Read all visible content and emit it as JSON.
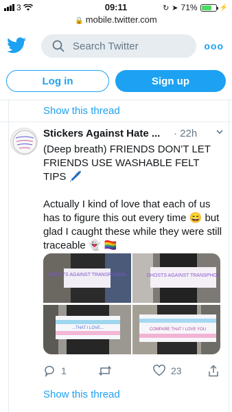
{
  "status_bar": {
    "carrier": "3",
    "time": "09:11",
    "battery": "71%",
    "battery_level": 0.71
  },
  "url_bar": {
    "url": "mobile.twitter.com"
  },
  "header": {
    "search_placeholder": "Search Twitter",
    "more_label": "ooo"
  },
  "auth": {
    "login_label": "Log in",
    "signup_label": "Sign up"
  },
  "thread_links": {
    "show_thread": "Show this thread"
  },
  "tweet": {
    "display_name": "Stickers Against Hate ...",
    "time": "22h",
    "text_line1": "(Deep breath) FRIENDS DON’T LET FRIENDS USE WASHABLE FELT TIPS 🖊️",
    "text_line2": "Actually I kind of love that each of us has to figure this out every time 😄 but glad I caught these while they were still traceable 👻 🏳️‍🌈",
    "replies": "1",
    "retweets": "",
    "likes": "23"
  },
  "media": {
    "tile1_text": "GHOSTS AGAINST TRANSPHOBIA",
    "tile2_text": "GHOSTS AGAINST TRANSPHOB",
    "tile3_text": "...THAT I LOVE...",
    "tile4_text": "COMPARE THAT I LOVE YOU"
  },
  "colors": {
    "brand": "#1da1f2",
    "muted": "#657786",
    "border": "#e6ecf0"
  }
}
